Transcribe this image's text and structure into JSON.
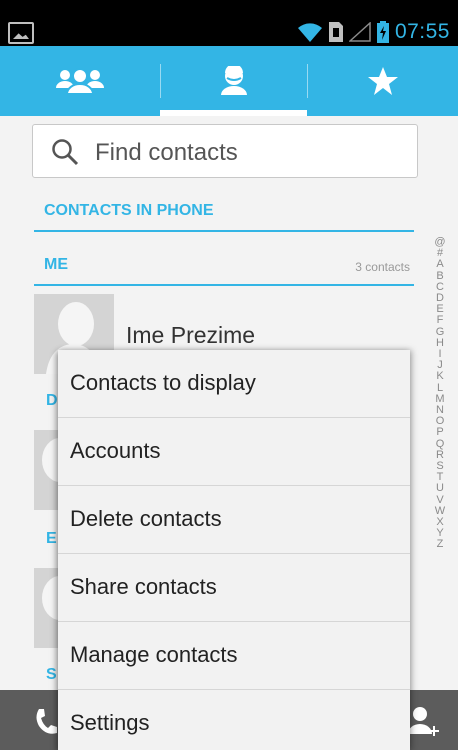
{
  "status_bar": {
    "time": "07:55"
  },
  "tabs": [
    {
      "icon": "groups-icon"
    },
    {
      "icon": "person-icon",
      "selected": true
    },
    {
      "icon": "star-icon"
    }
  ],
  "search": {
    "placeholder": "Find contacts"
  },
  "sections": {
    "contacts_in_phone": "CONTACTS IN PHONE",
    "me": {
      "title": "ME",
      "count": "3 contacts"
    }
  },
  "contacts": [
    {
      "name": "Ime Prezime"
    }
  ],
  "partial_headers": [
    "D",
    "E",
    "S"
  ],
  "alpha_index": [
    "@",
    "#",
    "A",
    "B",
    "C",
    "D",
    "E",
    "F",
    "G",
    "H",
    "I",
    "J",
    "K",
    "L",
    "M",
    "N",
    "O",
    "P",
    "Q",
    "R",
    "S",
    "T",
    "U",
    "V",
    "W",
    "X",
    "Y",
    "Z"
  ],
  "menu": {
    "items": [
      {
        "label": "Contacts to display"
      },
      {
        "label": "Accounts"
      },
      {
        "label": "Delete contacts"
      },
      {
        "label": "Share contacts"
      },
      {
        "label": "Manage contacts"
      },
      {
        "label": "Settings"
      }
    ]
  },
  "colors": {
    "accent": "#33b5e5",
    "background": "#f3f3f3",
    "bottom_bar": "#5c5c5c"
  }
}
